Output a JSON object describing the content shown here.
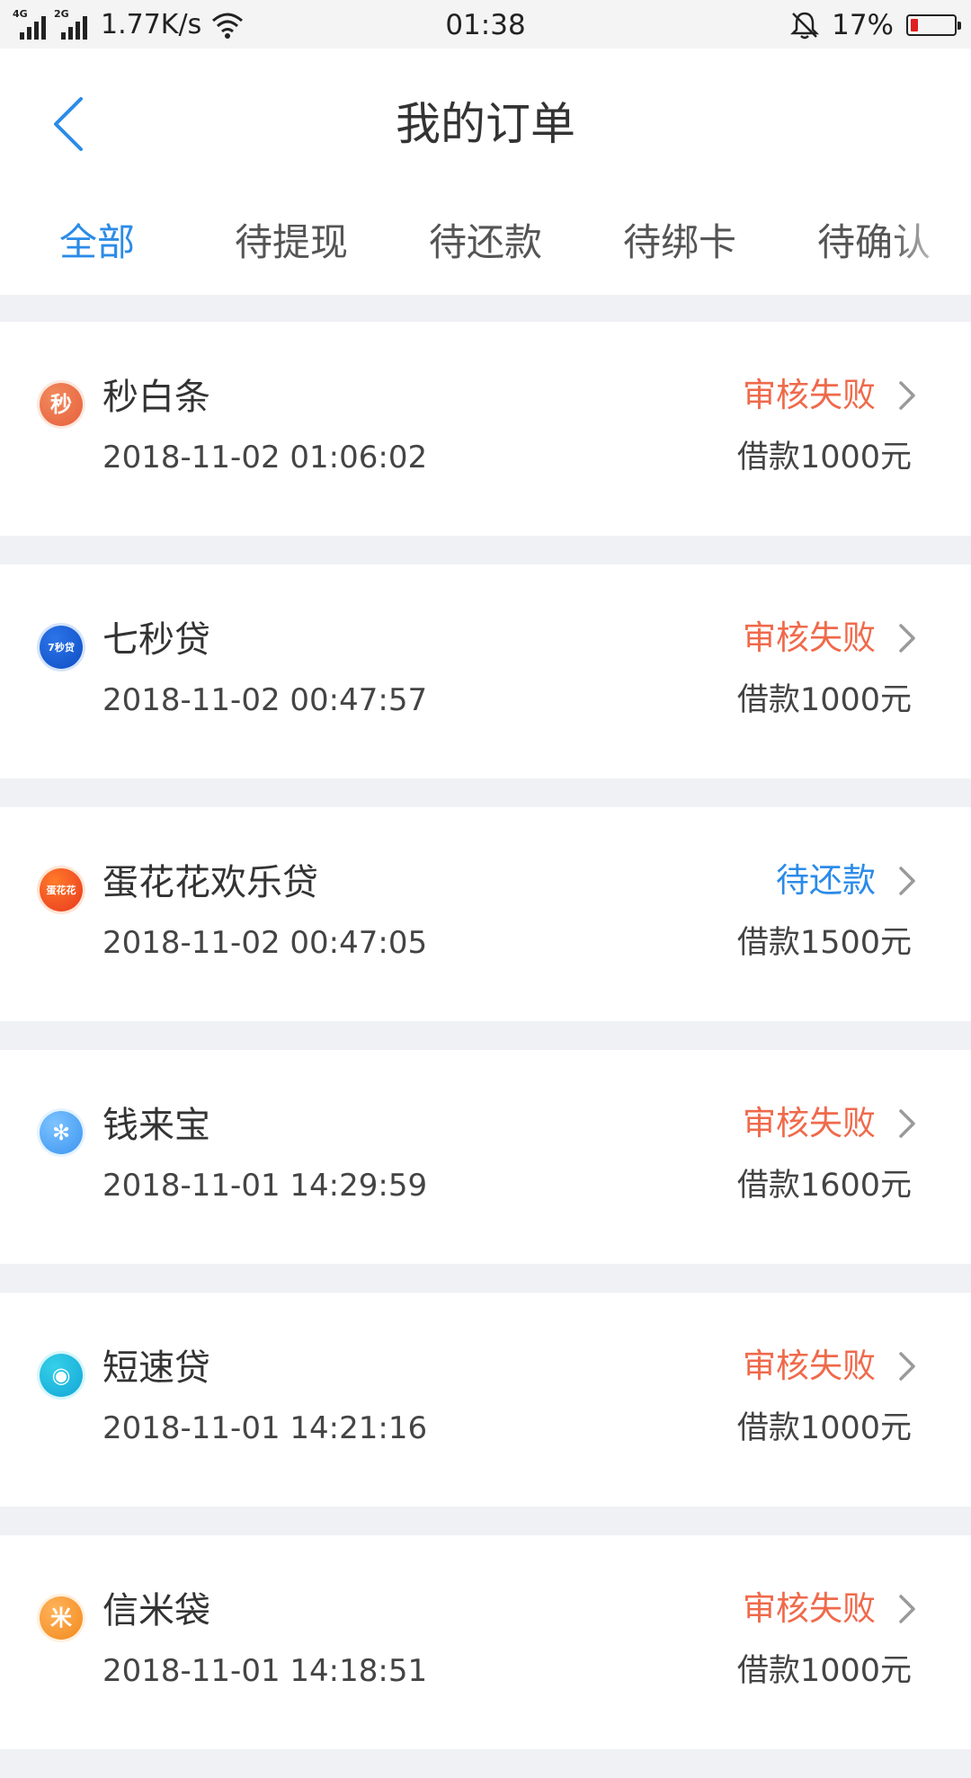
{
  "status_bar": {
    "network_1": "4G",
    "network_2": "2G",
    "speed": "1.77K/s",
    "time": "01:38",
    "battery_percent": "17%",
    "battery_level": 0.17,
    "battery_color": "#e02020",
    "icons": [
      "signal-icon",
      "wifi-icon",
      "bell-off-icon",
      "battery-icon"
    ]
  },
  "header": {
    "title": "我的订单",
    "back_icon": "chevron-left-icon"
  },
  "tabs": [
    {
      "label": "全部",
      "active": true
    },
    {
      "label": "待提现",
      "active": false
    },
    {
      "label": "待还款",
      "active": false
    },
    {
      "label": "待绑卡",
      "active": false
    },
    {
      "label": "待确认",
      "active": false
    }
  ],
  "colors": {
    "accent": "#2b8be8",
    "status_fail": "#ef6a4b",
    "status_due": "#2b8be8",
    "page_bg": "#f0f1f5"
  },
  "orders": [
    {
      "name": "秒白条",
      "time": "2018-11-02 01:06:02",
      "status": "审核失败",
      "status_type": "fail",
      "amount": "借款1000元",
      "icon": {
        "glyph": "秒",
        "colors": [
          "#f08a5d",
          "#e8603c"
        ]
      }
    },
    {
      "name": "七秒贷",
      "time": "2018-11-02 00:47:57",
      "status": "审核失败",
      "status_type": "fail",
      "amount": "借款1000元",
      "icon": {
        "glyph": "7秒贷",
        "colors": [
          "#2c74e8",
          "#0e4fc4"
        ]
      }
    },
    {
      "name": "蛋花花欢乐贷",
      "time": "2018-11-02 00:47:05",
      "status": "待还款",
      "status_type": "due",
      "amount": "借款1500元",
      "icon": {
        "glyph": "蛋花花",
        "colors": [
          "#ff7a2a",
          "#e8391f"
        ]
      }
    },
    {
      "name": "钱来宝",
      "time": "2018-11-01 14:29:59",
      "status": "审核失败",
      "status_type": "fail",
      "amount": "借款1600元",
      "icon": {
        "glyph": "✻",
        "colors": [
          "#7ec3ff",
          "#3a94f0"
        ]
      }
    },
    {
      "name": "短速贷",
      "time": "2018-11-01 14:21:16",
      "status": "审核失败",
      "status_type": "fail",
      "amount": "借款1000元",
      "icon": {
        "glyph": "◉",
        "colors": [
          "#35d0e8",
          "#13a6d8"
        ]
      }
    },
    {
      "name": "信米袋",
      "time": "2018-11-01 14:18:51",
      "status": "审核失败",
      "status_type": "fail",
      "amount": "借款1000元",
      "icon": {
        "glyph": "米",
        "colors": [
          "#ffb25a",
          "#f28a1e"
        ]
      }
    }
  ]
}
